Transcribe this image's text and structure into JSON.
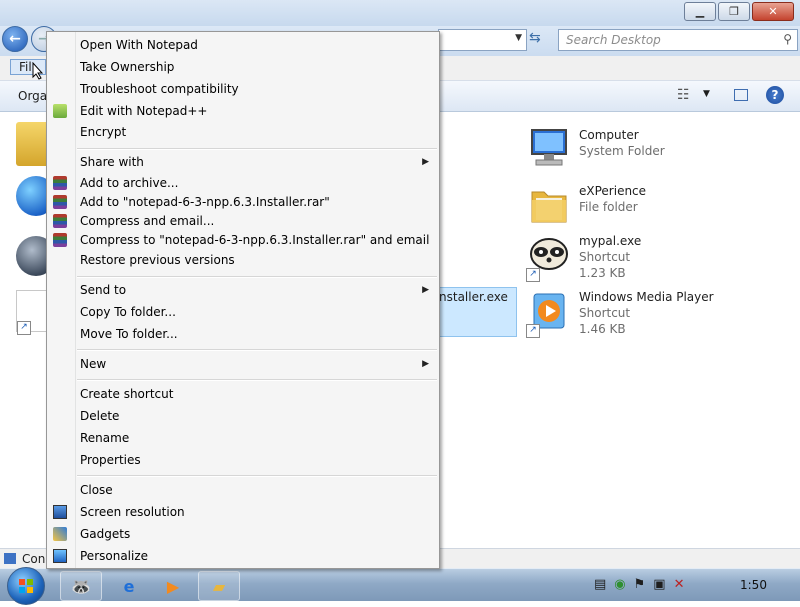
{
  "search": {
    "placeholder": "Search Desktop"
  },
  "menubar": {
    "file_label": "Fil"
  },
  "cmdbar": {
    "organize_label": "Orga"
  },
  "status": {
    "text": "Con"
  },
  "selected_item": {
    "name_fragment": "nstaller.exe"
  },
  "items": [
    {
      "name": "Computer",
      "type": "System Folder",
      "size": "",
      "icon": "computer-icon"
    },
    {
      "name": "eXPerience",
      "type": "File folder",
      "size": "",
      "icon": "folder-icon"
    },
    {
      "name": "mypal.exe",
      "type": "Shortcut",
      "size": "1.23 KB",
      "icon": "raccoon-icon"
    },
    {
      "name": "Windows Media Player",
      "type": "Shortcut",
      "size": "1.46 KB",
      "icon": "media-player-icon"
    }
  ],
  "context_menu": {
    "items": [
      {
        "label": "Open With Notepad",
        "icon": ""
      },
      {
        "label": "Take Ownership",
        "icon": ""
      },
      {
        "label": "Troubleshoot compatibility",
        "icon": ""
      },
      {
        "label": "Edit with Notepad++",
        "icon": "notepadpp-icon"
      },
      {
        "label": "Encrypt",
        "icon": ""
      },
      {
        "label": "Share with",
        "icon": "",
        "submenu": true
      },
      {
        "label": "Add to archive...",
        "icon": "winrar-icon"
      },
      {
        "label": "Add to \"notepad-6-3-npp.6.3.Installer.rar\"",
        "icon": "winrar-icon"
      },
      {
        "label": "Compress and email...",
        "icon": "winrar-icon"
      },
      {
        "label": "Compress to \"notepad-6-3-npp.6.3.Installer.rar\" and email",
        "icon": "winrar-icon"
      },
      {
        "label": "Restore previous versions",
        "icon": ""
      },
      {
        "label": "Send to",
        "icon": "",
        "submenu": true
      },
      {
        "label": "Copy To folder...",
        "icon": ""
      },
      {
        "label": "Move To folder...",
        "icon": ""
      },
      {
        "label": "New",
        "icon": "",
        "submenu": true
      },
      {
        "label": "Create shortcut",
        "icon": ""
      },
      {
        "label": "Delete",
        "icon": ""
      },
      {
        "label": "Rename",
        "icon": ""
      },
      {
        "label": "Properties",
        "icon": ""
      },
      {
        "label": "Close",
        "icon": ""
      },
      {
        "label": "Screen resolution",
        "icon": "monitor-icon"
      },
      {
        "label": "Gadgets",
        "icon": "gadgets-icon"
      },
      {
        "label": "Personalize",
        "icon": "personalize-icon"
      }
    ]
  },
  "taskbar": {
    "clock": "1:50"
  },
  "colors": {
    "selection": "#cce8ff",
    "menu_bg": "#f5f5f5",
    "taskbar": "#8fa9c6"
  }
}
